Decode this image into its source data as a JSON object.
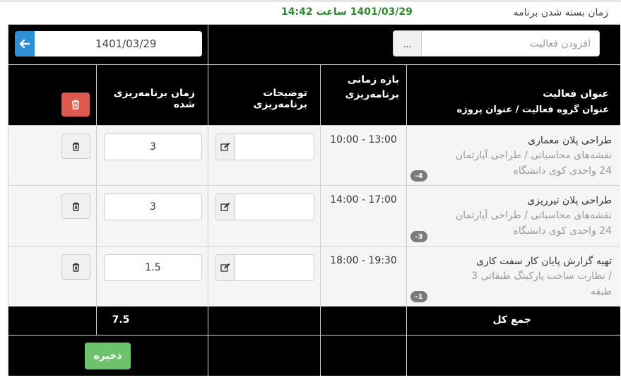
{
  "close_info": {
    "label": "زمان بسته شدن برنامه",
    "value": "1401/03/29 ساعت 14:42"
  },
  "date_nav": {
    "date": "1401/03/29",
    "prev_icon": "arrow-left-icon",
    "next_icon": "arrow-right-icon"
  },
  "add_activity": {
    "placeholder": "افزودن فعالیت",
    "button_label": "..."
  },
  "headers": {
    "activity_title": "عنوان فعالیت",
    "activity_sub": "عنوان گروه فعالیت  /  عنوان پروژه",
    "time_range_line1": "بازه زمانی",
    "time_range_line2": "برنامه‌ریزی",
    "description": "توضیحات برنامه‌ریزی",
    "planned_time": "زمان برنامه‌ریزی شده"
  },
  "rows": [
    {
      "title": "طراحی پلان معماری",
      "sub_line1": "نقشه‌های محاسباتی  /  طراحی آپارتمان",
      "sub_line2": "24 واحدی کوی دانشگاه",
      "badge": "-4",
      "time_range": "10:00  -  13:00",
      "hours": "3"
    },
    {
      "title": "طراحی پلان تیرریزی",
      "sub_line1": "نقشه‌های محاسباتی  /  طراحی آپارتمان",
      "sub_line2": "24 واحدی کوی دانشگاه",
      "badge": "-3",
      "time_range": "14:00  -  17:00",
      "hours": "3"
    },
    {
      "title": "تهیه گزارش پایان کار سفت کاری",
      "sub_line1": " /  نظارت ساخت پارکینگ طبقاتی 3",
      "sub_line2": "طبقه",
      "badge": "-1",
      "time_range": "18:00  -  19:30",
      "hours": "1.5"
    }
  ],
  "total": {
    "label": "جمع کل",
    "value": "7.5"
  },
  "save_label": "ذخیره",
  "colors": {
    "header_bg": "#000000",
    "accent_blue": "#2d8fd6",
    "danger": "#e0594e",
    "success": "#6cc36c",
    "time_green": "#2b8a2b"
  }
}
